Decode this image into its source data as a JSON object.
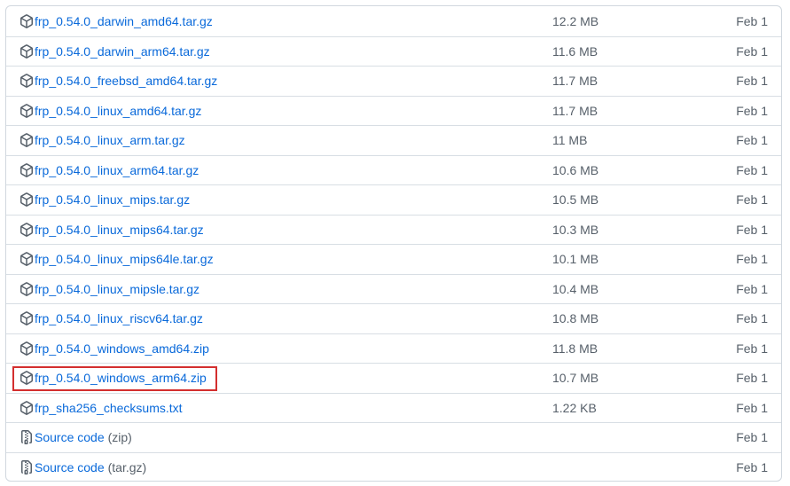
{
  "assets": [
    {
      "name": "frp_0.54.0_darwin_amd64.tar.gz",
      "size": "12.2 MB",
      "date": "Feb 1",
      "icon": "package-icon"
    },
    {
      "name": "frp_0.54.0_darwin_arm64.tar.gz",
      "size": "11.6 MB",
      "date": "Feb 1",
      "icon": "package-icon"
    },
    {
      "name": "frp_0.54.0_freebsd_amd64.tar.gz",
      "size": "11.7 MB",
      "date": "Feb 1",
      "icon": "package-icon"
    },
    {
      "name": "frp_0.54.0_linux_amd64.tar.gz",
      "size": "11.7 MB",
      "date": "Feb 1",
      "icon": "package-icon"
    },
    {
      "name": "frp_0.54.0_linux_arm.tar.gz",
      "size": "11 MB",
      "date": "Feb 1",
      "icon": "package-icon"
    },
    {
      "name": "frp_0.54.0_linux_arm64.tar.gz",
      "size": "10.6 MB",
      "date": "Feb 1",
      "icon": "package-icon"
    },
    {
      "name": "frp_0.54.0_linux_mips.tar.gz",
      "size": "10.5 MB",
      "date": "Feb 1",
      "icon": "package-icon"
    },
    {
      "name": "frp_0.54.0_linux_mips64.tar.gz",
      "size": "10.3 MB",
      "date": "Feb 1",
      "icon": "package-icon"
    },
    {
      "name": "frp_0.54.0_linux_mips64le.tar.gz",
      "size": "10.1 MB",
      "date": "Feb 1",
      "icon": "package-icon"
    },
    {
      "name": "frp_0.54.0_linux_mipsle.tar.gz",
      "size": "10.4 MB",
      "date": "Feb 1",
      "icon": "package-icon"
    },
    {
      "name": "frp_0.54.0_linux_riscv64.tar.gz",
      "size": "10.8 MB",
      "date": "Feb 1",
      "icon": "package-icon"
    },
    {
      "name": "frp_0.54.0_windows_amd64.zip",
      "size": "11.8 MB",
      "date": "Feb 1",
      "icon": "package-icon"
    },
    {
      "name": "frp_0.54.0_windows_arm64.zip",
      "size": "10.7 MB",
      "date": "Feb 1",
      "icon": "package-icon",
      "highlighted": true
    },
    {
      "name": "frp_sha256_checksums.txt",
      "size": "1.22 KB",
      "date": "Feb 1",
      "icon": "package-icon"
    },
    {
      "name": "Source code",
      "suffix": "(zip)",
      "size": "",
      "date": "Feb 1",
      "icon": "file-zip-icon"
    },
    {
      "name": "Source code",
      "suffix": "(tar.gz)",
      "size": "",
      "date": "Feb 1",
      "icon": "file-zip-icon"
    }
  ],
  "colors": {
    "link": "#0969da",
    "muted": "#57606a",
    "highlight": "#d32f2f"
  }
}
